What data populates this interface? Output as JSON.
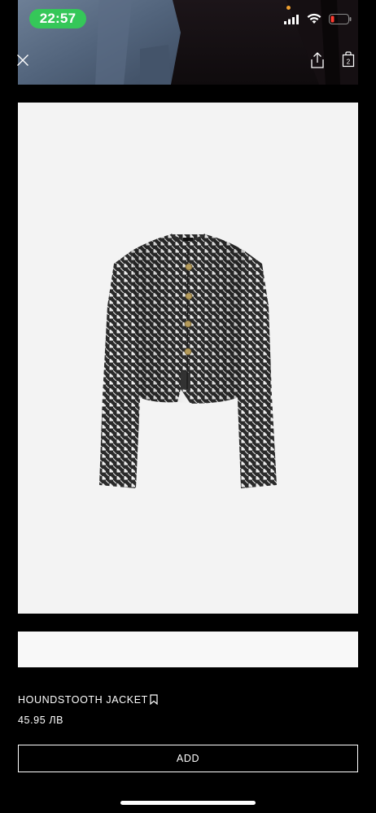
{
  "status_bar": {
    "time": "22:57"
  },
  "toolbar": {
    "close_icon": "close-icon",
    "share_icon": "share-icon",
    "bag_icon": "shopping-bag-icon",
    "bag_count": "2"
  },
  "product": {
    "name": "HOUNDSTOOTH JACKET",
    "price": "45.95 ЛВ",
    "add_label": "ADD",
    "bookmark_icon": "bookmark-icon"
  },
  "colors": {
    "time_pill": "#35c759",
    "background": "#000000",
    "image_background": "#f3f3f3",
    "battery_low": "#ff3b30"
  }
}
